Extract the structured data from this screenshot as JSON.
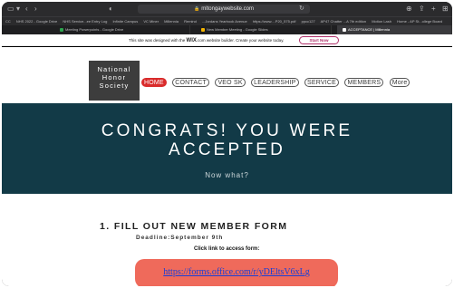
{
  "browser": {
    "url": "mltongaywebsite.com",
    "bookmarks": [
      "CC",
      "NHS 2022 - Google Drive",
      "NHS Service...ee Entry Log",
      "Infinite Campus",
      "VC Miner",
      "Millennia",
      "Remind",
      "...Jordans Yearbook Avenue",
      "https://www....P20_575.pdf",
      "ppcc127",
      "AP47 Chatter ...A 7th edition",
      "Motion Lash",
      "Home - AP St...ollege Board"
    ],
    "tabs": [
      {
        "label": "Meeting Powerpoints - Google Drive",
        "active": false,
        "color": "#2da44e"
      },
      {
        "label": "New Member Meeting - Google Slides",
        "active": false,
        "color": "#f4b400"
      },
      {
        "label": "ACCEPTANCE | Millennia",
        "active": true,
        "color": "#ffffff"
      }
    ]
  },
  "wix": {
    "message_prefix": "This site was designed with the ",
    "brand": "WIX",
    "message_suffix": ".com website builder. Create your website today.",
    "button": "Start Now"
  },
  "site": {
    "logo_lines": [
      "National",
      "Honor",
      "Society"
    ],
    "nav": [
      "HOME",
      "CONTACT",
      "VEO SK",
      "LEADERSHIP",
      "SERVICE",
      "MEMBERS",
      "More"
    ],
    "active_nav": "HOME"
  },
  "hero": {
    "title_line1": "CONGRATS! YOU WERE",
    "title_line2": "ACCEPTED",
    "subtitle": "Now what?"
  },
  "content": {
    "step_title": "1. FILL OUT NEW MEMBER FORM",
    "deadline": "Deadline:September 9th",
    "instruction": "Click link to access form:",
    "form_link": "https://forms.office.com/r/yDEltsV6xLg"
  },
  "colors": {
    "hero_bg": "#123a47",
    "nav_active": "#d92b2b",
    "link_box": "#ef6a5b",
    "wix_accent": "#b0306a"
  }
}
